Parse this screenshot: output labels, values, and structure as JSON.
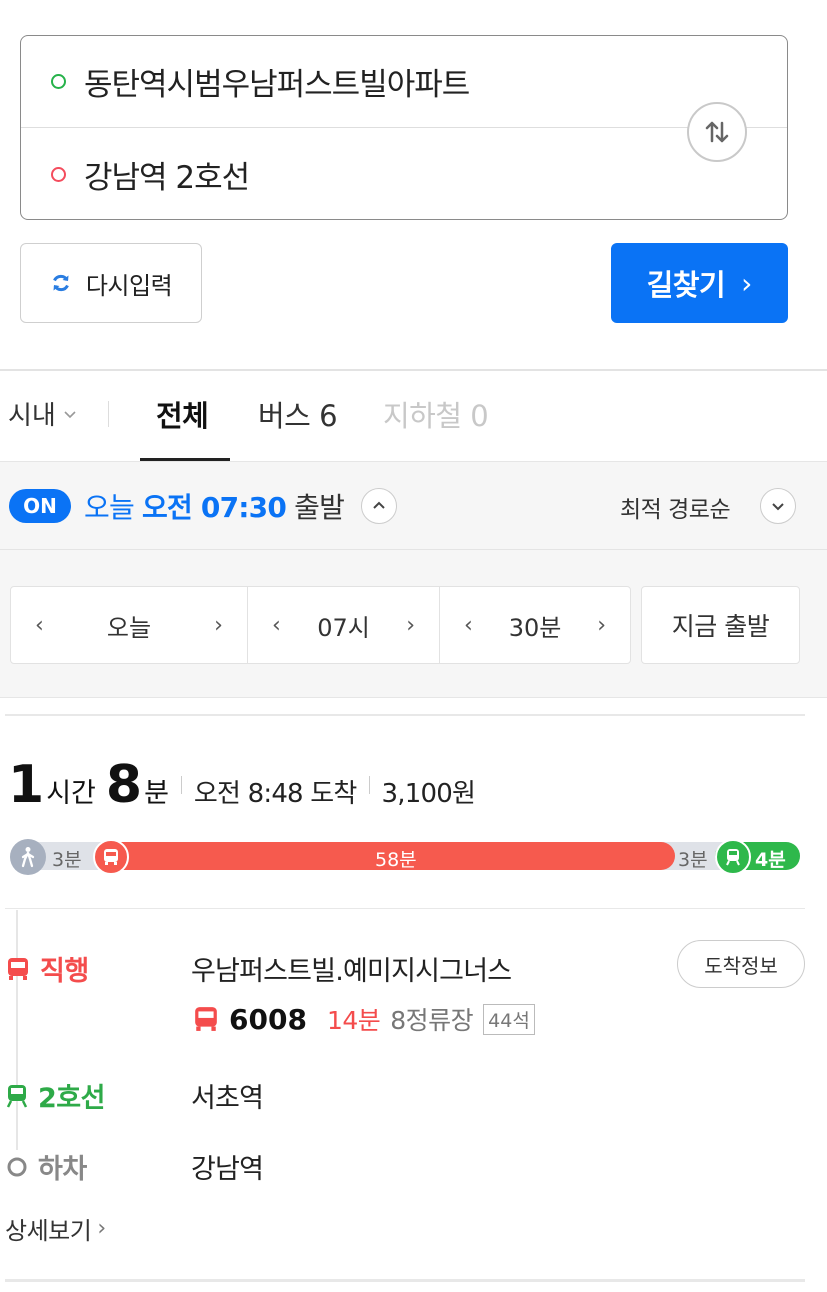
{
  "search": {
    "origin": "동탄역시범우남퍼스트빌아파트",
    "destination": "강남역 2호선"
  },
  "buttons": {
    "reset": "다시입력",
    "find": "길찾기",
    "find_chevron": "›"
  },
  "tabs": {
    "region": "시내",
    "all": "전체",
    "bus": "버스 6",
    "subway": "지하철 0"
  },
  "time": {
    "on_badge": "ON",
    "day": "오늘",
    "ampm_time": "오전 07:30",
    "depart": "출발",
    "sort": "최적 경로순"
  },
  "picker": {
    "day": "오늘",
    "hour": "07시",
    "minute": "30분",
    "prev": "‹",
    "next": "›",
    "now": "지금 출발"
  },
  "route": {
    "hours": "1",
    "hours_unit": "시간",
    "minutes": "8",
    "minutes_unit": "분",
    "arrival": "오전 8:48 도착",
    "fare": "3,100원",
    "segments": {
      "walk_start": "3분",
      "bus": "58분",
      "walk_mid": "3분",
      "subway": "4분"
    },
    "steps": [
      {
        "type": "직행",
        "station": "우남퍼스트빌.예미지시그너스"
      },
      {
        "type": "2호선",
        "station": "서초역"
      },
      {
        "type": "하차",
        "station": "강남역"
      }
    ],
    "arrival_info": "도착정보",
    "bus": {
      "number": "6008",
      "wait": "14분",
      "stops": "8정류장",
      "seats": "44석"
    },
    "detail": "상세보기",
    "detail_chevron": "›"
  },
  "colors": {
    "primary": "#0a73f5",
    "bus": "#f65a4e",
    "subway": "#2eb84b",
    "walk": "#a7b0bf"
  }
}
